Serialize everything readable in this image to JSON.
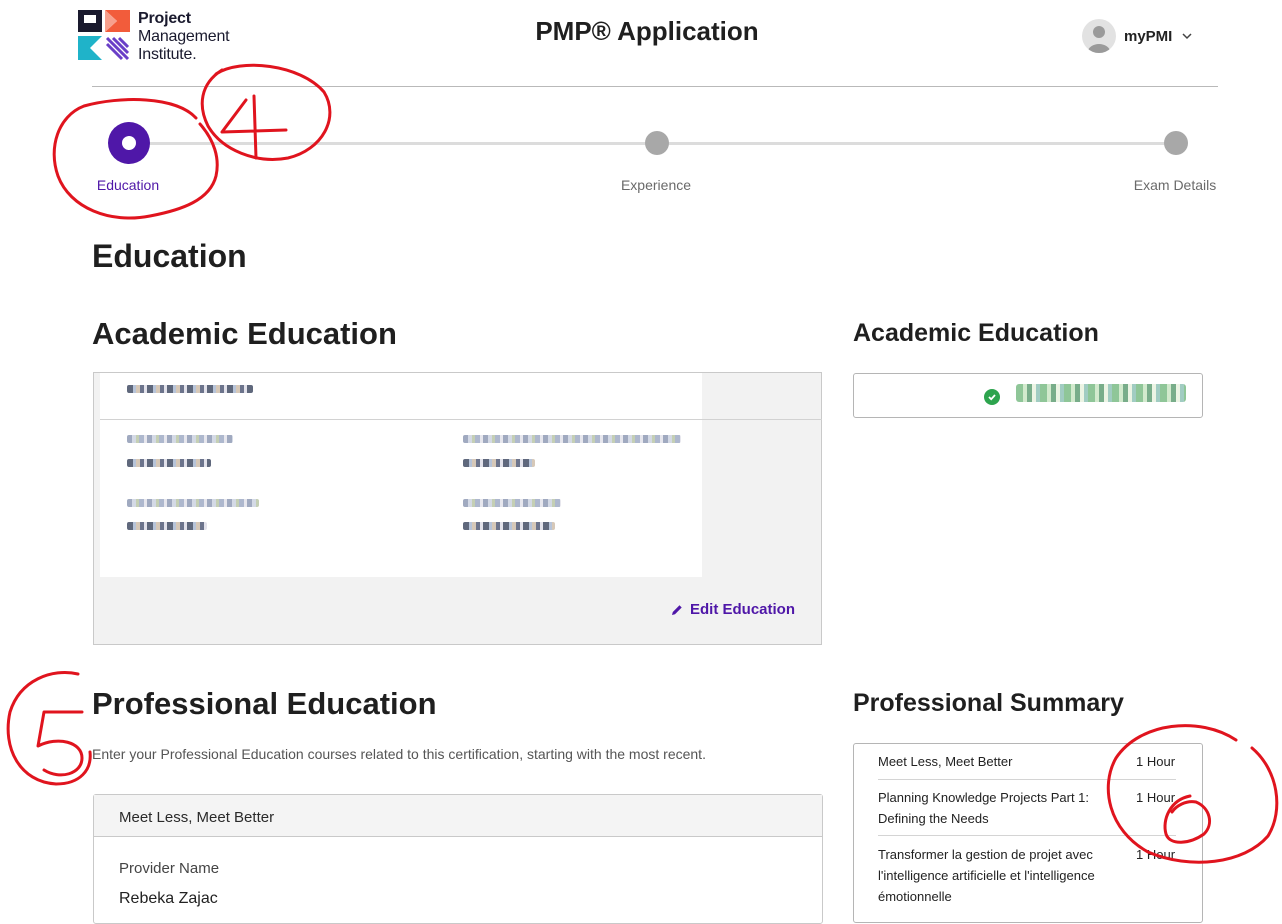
{
  "header": {
    "logo_lines": [
      "Project",
      "Management",
      "Institute."
    ],
    "app_title": "PMP® Application",
    "user_menu_label": "myPMI"
  },
  "stepper": {
    "steps": [
      {
        "label": "Education",
        "active": true
      },
      {
        "label": "Experience",
        "active": false
      },
      {
        "label": "Exam Details",
        "active": false
      }
    ]
  },
  "page_title": "Education",
  "academic": {
    "heading": "Academic Education",
    "edit_label": "Edit Education",
    "summary_heading": "Academic Education"
  },
  "professional": {
    "heading": "Professional Education",
    "description": "Enter your Professional Education courses related to this certification, starting with the most recent.",
    "course_card": {
      "course_name": "Meet Less, Meet Better",
      "provider_label": "Provider Name",
      "provider_value": "Rebeka Zajac"
    },
    "summary_heading": "Professional Summary",
    "summary_rows": [
      {
        "title": "Meet Less, Meet Better",
        "hours": "1 Hour"
      },
      {
        "title": "Planning Knowledge Projects Part 1: Defining the Needs",
        "hours": "1 Hour"
      },
      {
        "title": "Transformer la gestion de projet avec l'intelligence artificielle et l'intelligence émotionnelle",
        "hours": "1 Hour"
      }
    ]
  },
  "annotations": {
    "numbers": [
      "4",
      "5",
      "6"
    ],
    "color": "#e0141e"
  },
  "colors": {
    "accent": "#4f17a8",
    "success": "#2da44e",
    "inactive_step": "#a8a8a8"
  }
}
